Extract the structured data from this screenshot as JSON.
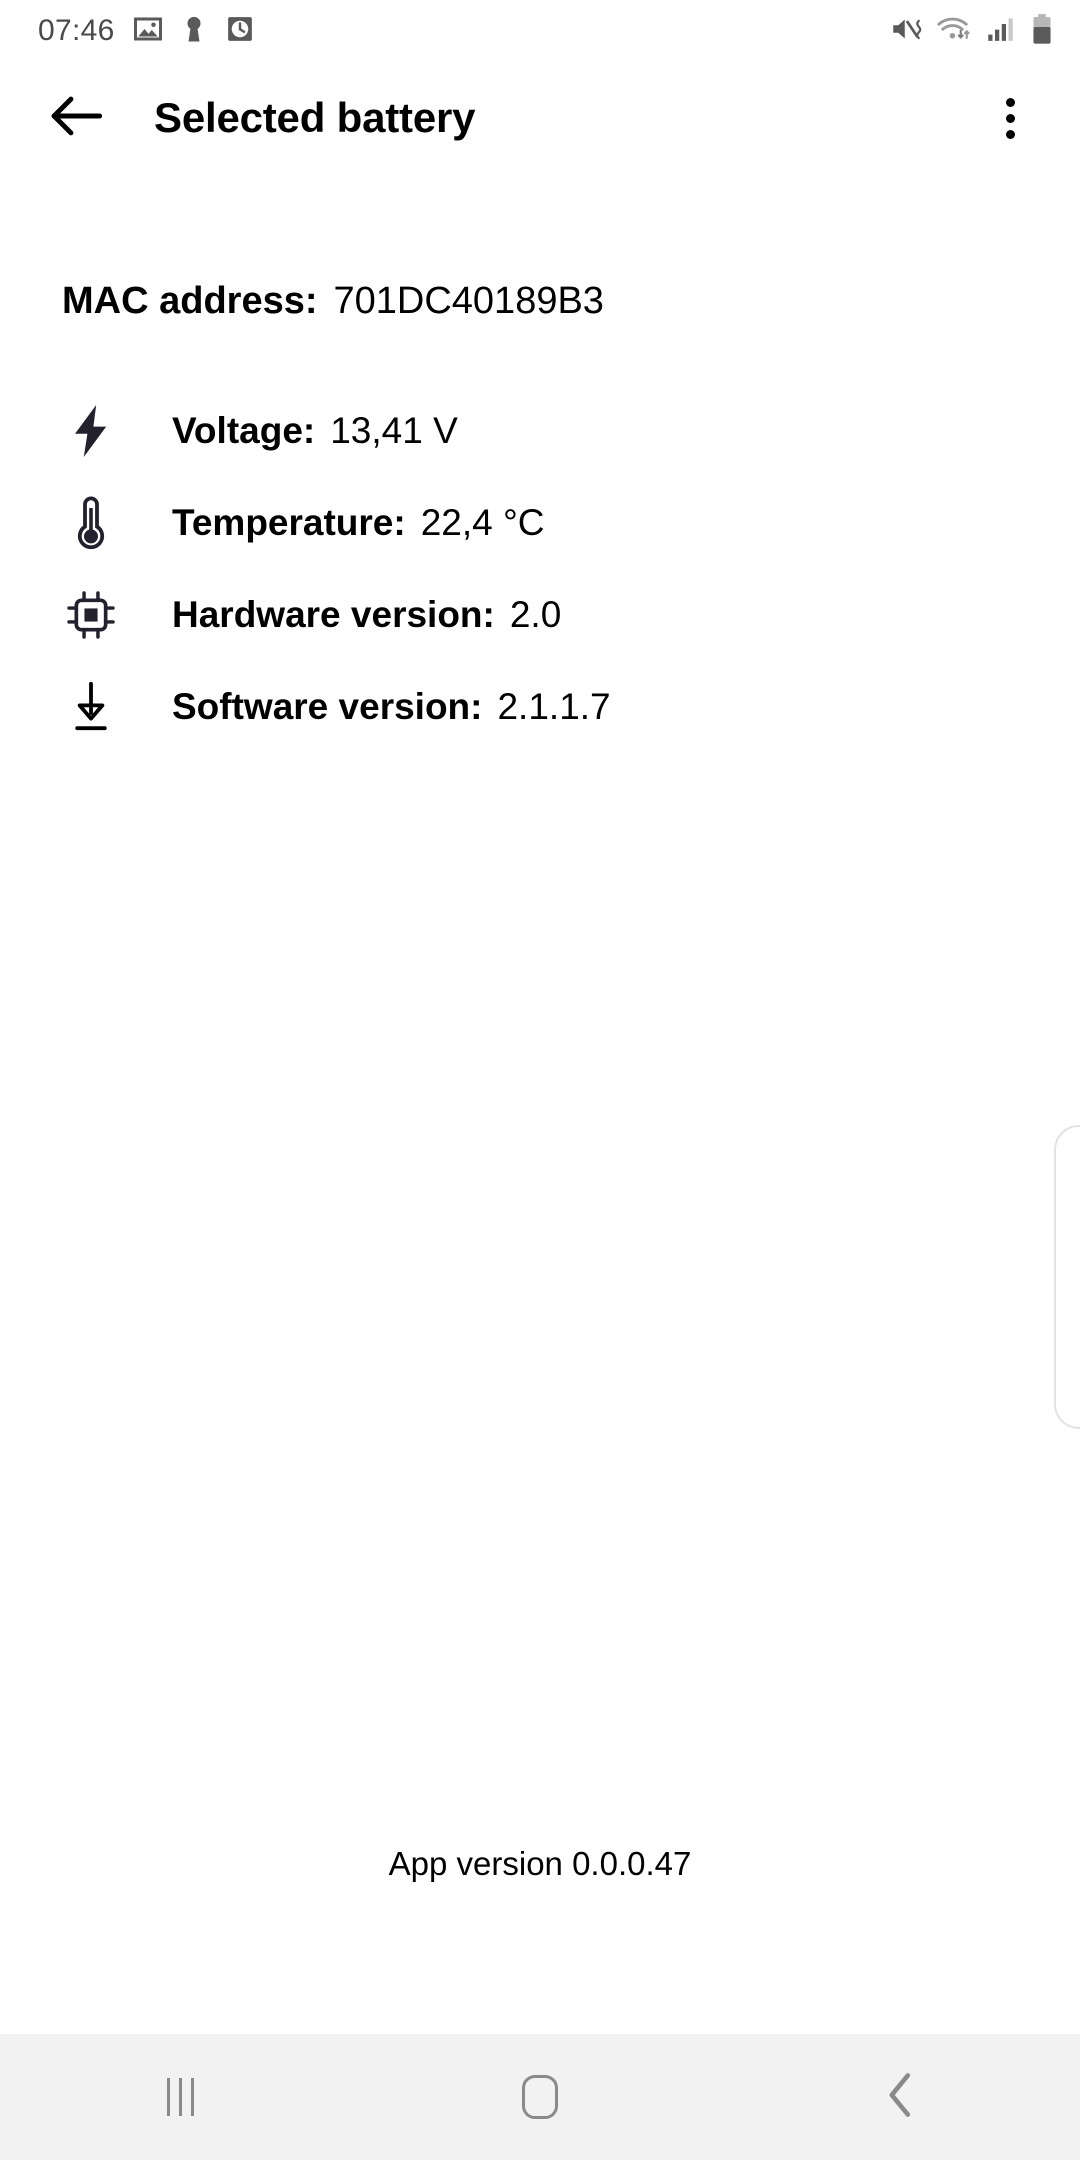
{
  "status_bar": {
    "time": "07:46",
    "left_icons": [
      "image-icon",
      "keyhole-icon",
      "alarm-clock-icon"
    ],
    "right_icons": [
      "mute-vibrate-icon",
      "wifi-transfer-icon",
      "signal-bars-icon",
      "battery-icon"
    ],
    "text_color": "#4a4a4a"
  },
  "app_bar": {
    "back_label": "back-arrow",
    "title": "Selected battery",
    "overflow_label": "more-options"
  },
  "device": {
    "mac_label": "MAC address:",
    "mac_value": "701DC40189B3",
    "rows": [
      {
        "icon": "lightning-bolt-icon",
        "label": "Voltage:",
        "value": "13,41 V"
      },
      {
        "icon": "thermometer-icon",
        "label": "Temperature:",
        "value": "22,4 °C"
      },
      {
        "icon": "chip-icon",
        "label": "Hardware version:",
        "value": "2.0"
      },
      {
        "icon": "download-arrow-icon",
        "label": "Software version:",
        "value": "2.1.1.7"
      }
    ]
  },
  "footer": {
    "app_version": "App version 0.0.0.47"
  },
  "nav_bar": {
    "recents_label": "recents-button",
    "home_label": "home-button",
    "back_label": "back-button",
    "background": "#f2f2f2",
    "icon_color": "#8a8a8a"
  }
}
